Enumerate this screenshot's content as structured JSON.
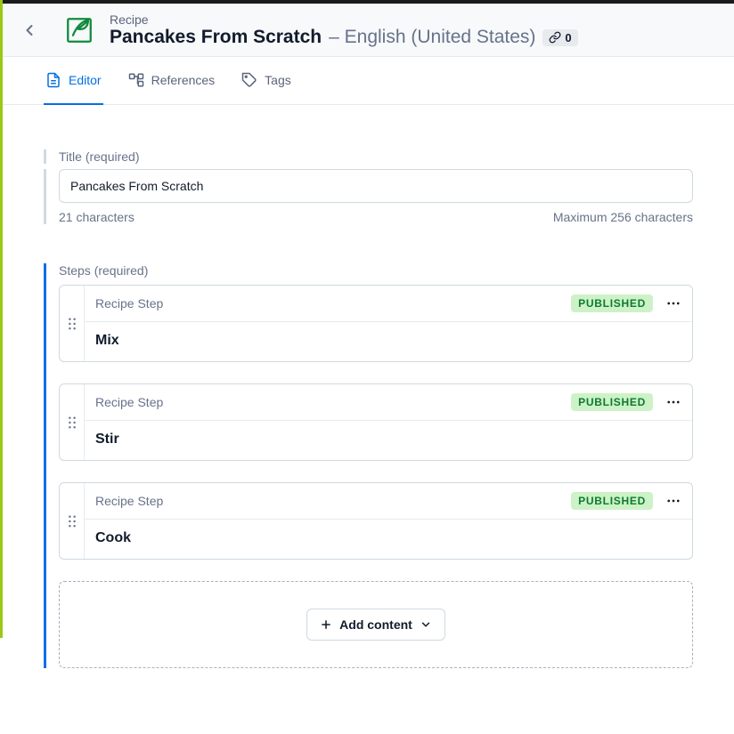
{
  "header": {
    "eyebrow": "Recipe",
    "title": "Pancakes From Scratch",
    "locale_separator": "– ",
    "locale": "English (United States)",
    "link_count": "0"
  },
  "tabs": {
    "editor": "Editor",
    "references": "References",
    "tags": "Tags"
  },
  "fields": {
    "title": {
      "label": "Title (required)",
      "value": "Pancakes From Scratch",
      "char_count": "21 characters",
      "max": "Maximum 256 characters"
    },
    "steps": {
      "label": "Steps (required)",
      "type_label": "Recipe Step",
      "status_label": "PUBLISHED",
      "items": [
        {
          "title": "Mix"
        },
        {
          "title": "Stir"
        },
        {
          "title": "Cook"
        }
      ],
      "add_label": "Add content"
    }
  }
}
